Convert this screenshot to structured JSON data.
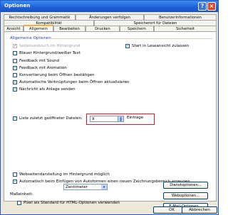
{
  "window": {
    "title": "Optionen"
  },
  "tabs": {
    "row1": [
      "Rechtschreibung und Grammatik",
      "Änderungen verfolgen",
      "Benutzerinformationen"
    ],
    "row2": [
      "Kompatibilität",
      "Speicherort für Dateien"
    ],
    "row3": [
      "Ansicht",
      "Allgemein",
      "Bearbeiten",
      "Drucken",
      "Speichern",
      "Sicherheit"
    ]
  },
  "general": {
    "section_title": "Allgemeine Optionen",
    "options": [
      {
        "label": "Seitenumbruch im Hintergrund",
        "checked": true,
        "disabled": true
      },
      {
        "label": "Blauer Hintergrund/weißer Text",
        "checked": false
      },
      {
        "label": "Feedback mit Sound",
        "checked": false
      },
      {
        "label": "Feedback mit Animation",
        "checked": true
      },
      {
        "label": "Konvertierung beim Öffnen bestätigen",
        "checked": false
      },
      {
        "label": "Automatische Verknüpfungen beim Öffnen aktualisieren",
        "checked": true
      },
      {
        "label": "Nachricht als Anlage senden",
        "checked": true
      },
      {
        "label": "Liste zuletzt geöffneter Dateien:",
        "checked": true
      }
    ],
    "right_option": {
      "label": "Start in Leseansicht zulassen",
      "checked": true
    },
    "recent_files_count": "9",
    "recent_files_unit": "Einträge",
    "bottom_options": [
      {
        "label": "Webseitendarstellung im Hintergrund möglich",
        "checked": false
      },
      {
        "label": "Automatisch beim Einfügen von Autoformen einen neuen Zeichnungsbereich erzeugen",
        "checked": true
      }
    ],
    "unit_label": "Maßeinheit:",
    "unit_value": "Zentimeter",
    "pixel_option": {
      "label": "Pixel als Standard für HTML-Optionen verwenden",
      "checked": false
    },
    "buttons": [
      "Dienstoptionen...",
      "Weboptionen...",
      "E-Mail-Optionen..."
    ]
  },
  "footer": {
    "ok": "OK",
    "cancel": "Abbrechen"
  },
  "colors": {
    "titlebar": "#1e5fd6",
    "highlight": "#e3162a",
    "section": "#2a3fa8"
  }
}
